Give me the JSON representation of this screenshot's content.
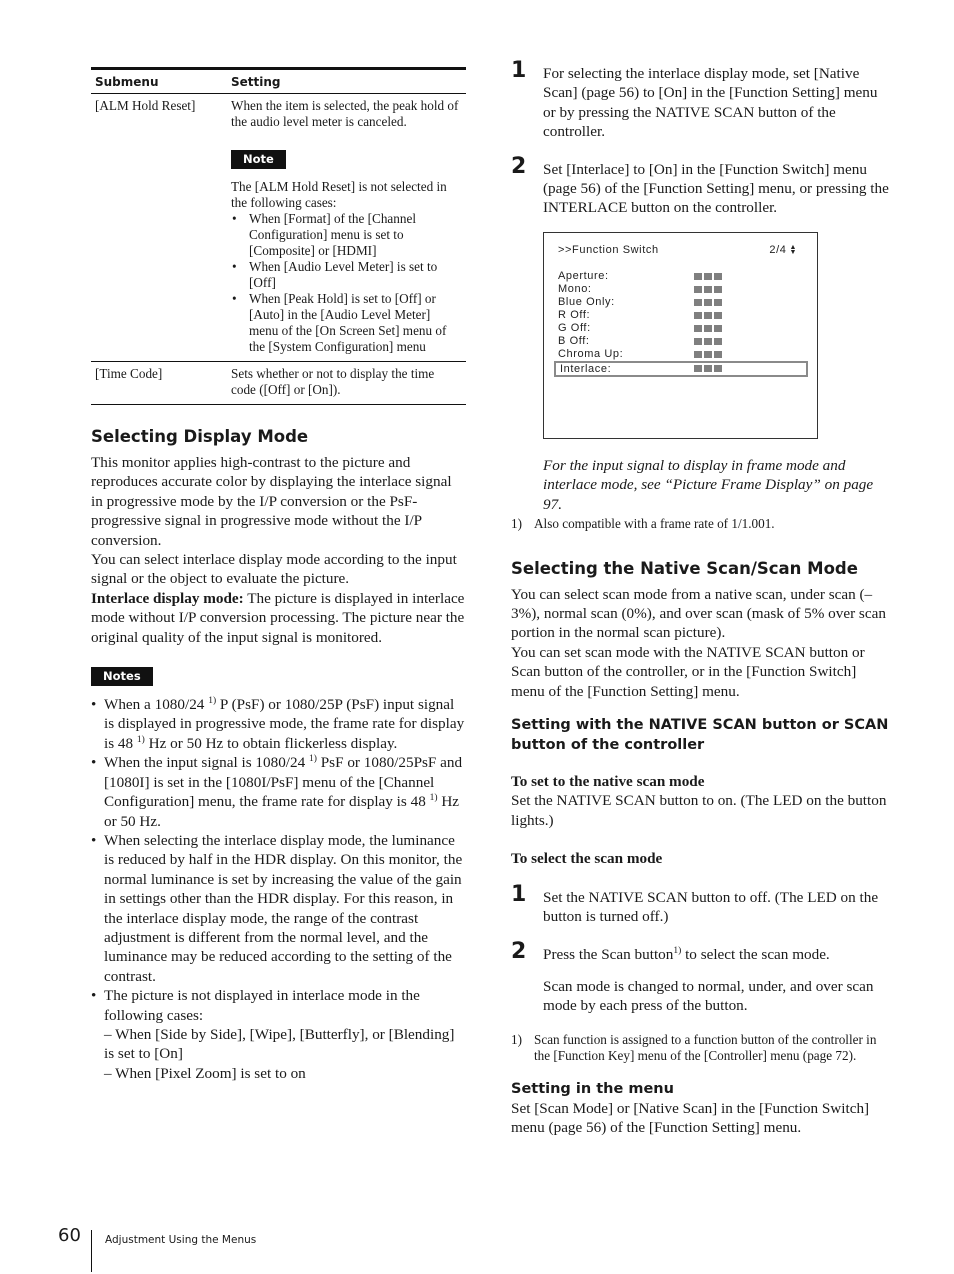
{
  "table": {
    "headers": [
      "Submenu",
      "Setting"
    ],
    "rows": [
      {
        "submenu": "[ALM Hold Reset]",
        "setting": "When the item is selected, the peak hold of the audio level meter is canceled.",
        "note_label": "Note",
        "note_intro": "The [ALM Hold Reset] is not selected in the following cases:",
        "note_items": [
          "When [Format] of the [Channel Configuration] menu is set to [Composite] or [HDMI]",
          "When [Audio Level Meter] is set to [Off]",
          "When [Peak Hold] is set to [Off] or [Auto] in the [Audio Level Meter] menu of the [On Screen Set] menu of the [System Configuration] menu"
        ]
      },
      {
        "submenu": "[Time Code]",
        "setting": "Sets whether or not to display the time code ([Off] or [On])."
      }
    ]
  },
  "display_mode": {
    "heading": "Selecting Display Mode",
    "para1": "This monitor applies high-contrast to the picture and reproduces accurate color by displaying the interlace signal in progressive mode by the I/P conversion or the PsF-progressive signal in progressive mode without the I/P conversion.",
    "para2": "You can select interlace display mode according to the input signal or the object to evaluate the picture.",
    "para3_head": "Interlace display mode:",
    "para3_body": " The picture is displayed in interlace mode without I/P conversion processing. The picture near the original quality of the input signal is monitored.",
    "notes_label": "Notes",
    "notes": {
      "n1_a": "When a 1080/24 ",
      "n1_sup1": "1)",
      "n1_b": " P (PsF) or 1080/25P (PsF) input signal is displayed in progressive mode, the frame rate for display is 48 ",
      "n1_sup2": "1)",
      "n1_c": " Hz or 50 Hz to obtain flickerless display.",
      "n2_a": "When the input signal is 1080/24 ",
      "n2_sup1": "1)",
      "n2_b": " PsF or 1080/25PsF and [1080I] is set in the [1080I/PsF] menu of the [Channel Configuration] menu, the frame rate for display is 48 ",
      "n2_sup2": "1)",
      "n2_c": " Hz or 50 Hz.",
      "n3": "When selecting the interlace display mode, the luminance is reduced by half in the HDR display. On this monitor, the normal luminance is set by increasing the value of the gain in settings other than the HDR display. For this reason, in the interlace display mode, the range of the contrast adjustment is different from the normal level, and the luminance may be reduced according to the setting of the contrast.",
      "n4": "The picture is not displayed in interlace mode in the following cases:",
      "n4_dash1": "– When [Side by Side], [Wipe], [Butterfly], or [Blending] is set to [On]",
      "n4_dash2": "– When [Pixel Zoom] is set to on"
    }
  },
  "interlace_steps": [
    {
      "num": "1",
      "text": "For selecting the interlace display mode, set [Native Scan] (page 56) to [On] in the [Function Setting] menu or by pressing the NATIVE SCAN button of the controller."
    },
    {
      "num": "2",
      "text": "Set [Interlace] to [On] in the [Function Switch] menu (page 56) of the [Function Setting] menu, or pressing the INTERLACE button on the controller."
    }
  ],
  "menu_screen": {
    "title": ">>Function Switch",
    "page": "2/4",
    "items": [
      "Aperture:",
      "Mono:",
      "Blue Only:",
      "R Off:",
      "G Off:",
      "B Off:",
      "Chroma Up:",
      "Interlace:"
    ],
    "selected_item": "Interlace:"
  },
  "frame_caption": "For the input signal to display in frame mode and interlace mode, see “Picture Frame Display” on page 97.",
  "footnote1": {
    "mark": "1)",
    "text": "Also compatible with a frame rate of 1/1.001."
  },
  "scan_mode": {
    "heading": "Selecting the Native Scan/Scan Mode",
    "para1": "You can select scan mode from a native scan, under scan (–3%), normal scan (0%), and over scan (mask of 5% over scan portion in the normal scan picture).",
    "para2": "You can set scan mode with the NATIVE SCAN button or Scan button of the controller, or in the [Function Switch] menu of the [Function Setting] menu.",
    "subheading": "Setting with the NATIVE SCAN button or SCAN button of the controller",
    "native_head": "To set to the native scan mode",
    "native_text": "Set the NATIVE SCAN button to on. (The LED on the button lights.)",
    "select_head": "To select the scan mode",
    "steps": [
      {
        "num": "1",
        "text": "Set the NATIVE SCAN button to off.  (The LED on the button is turned off.)"
      },
      {
        "num": "2",
        "text_a": "Press the Scan button",
        "sup": "1)",
        "text_b": " to select the scan mode.",
        "followup": "Scan mode is changed to normal, under, and over scan mode by each press of the button."
      }
    ],
    "footnote": {
      "mark": "1)",
      "text": "Scan function is assigned to a function button of the controller in the [Function Key] menu of the [Controller] menu (page 72)."
    },
    "menu_heading": "Setting in the menu",
    "menu_text": "Set [Scan Mode] or [Native Scan] in the [Function Switch] menu (page 56) of the [Function Setting] menu."
  },
  "footer": {
    "page_number": "60",
    "section_title": "Adjustment Using the Menus"
  }
}
